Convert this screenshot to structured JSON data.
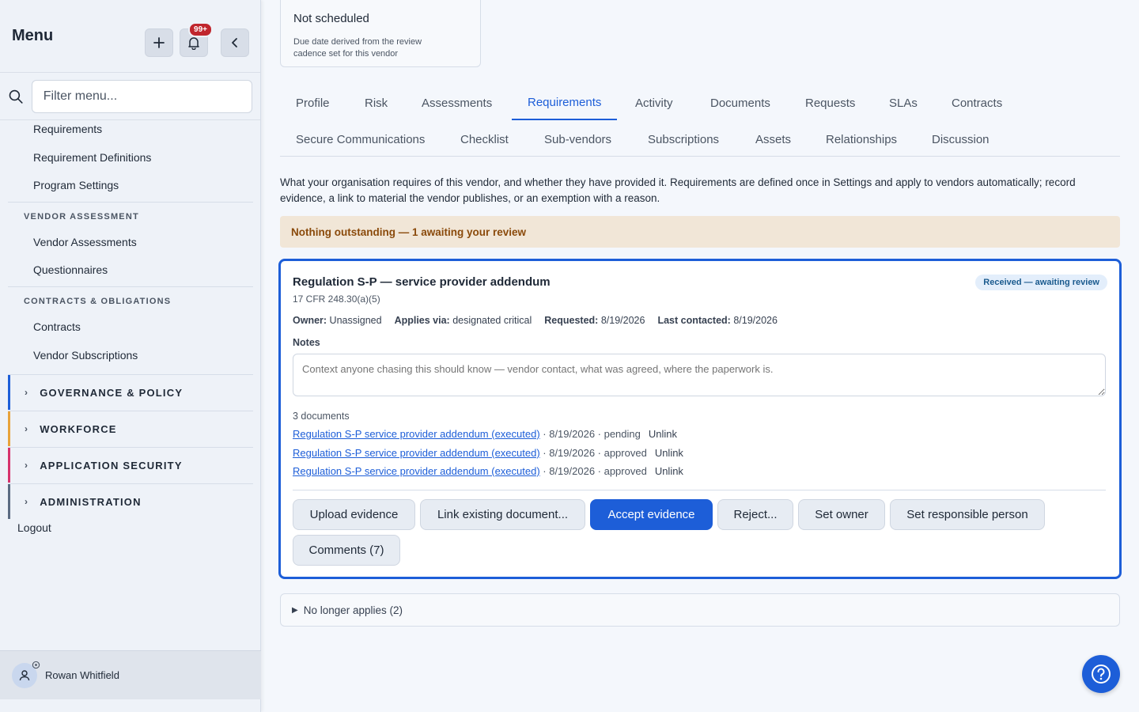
{
  "sidebar": {
    "title": "Menu",
    "badge": "99+",
    "filter_placeholder": "Filter menu...",
    "links": [
      "Requirements",
      "Requirement Definitions",
      "Program Settings"
    ],
    "vendor_assessment": {
      "heading": "VENDOR ASSESSMENT",
      "links": [
        "Vendor Assessments",
        "Questionnaires"
      ]
    },
    "contracts": {
      "heading": "CONTRACTS & OBLIGATIONS",
      "links": [
        "Contracts",
        "Vendor Subscriptions"
      ]
    },
    "groups": [
      {
        "label": "GOVERNANCE & POLICY",
        "color": "#1d5ed8"
      },
      {
        "label": "WORKFORCE",
        "color": "#e8a33a"
      },
      {
        "label": "APPLICATION SECURITY",
        "color": "#d6336c"
      },
      {
        "label": "ADMINISTRATION",
        "color": "#5b6b82"
      }
    ],
    "logout": "Logout",
    "user": "Rowan Whitfield"
  },
  "schedule": {
    "title": "Not scheduled",
    "subtitle": "Due date derived from the review cadence set for this vendor"
  },
  "tabs": {
    "row1": [
      "Profile",
      "Risk",
      "Assessments",
      "Requirements",
      "Activity",
      "Documents",
      "Requests",
      "SLAs",
      "Contracts"
    ],
    "row2": [
      "Secure Communications",
      "Checklist",
      "Sub-vendors",
      "Subscriptions",
      "Assets",
      "Relationships",
      "Discussion"
    ],
    "active": "Requirements"
  },
  "description": "What your organisation requires of this vendor, and whether they have provided it. Requirements are defined once in Settings and apply to vendors automatically; record evidence, a link to material the vendor publishes, or an exemption with a reason.",
  "banner": "Nothing outstanding — 1 awaiting your review",
  "requirement": {
    "title": "Regulation S-P — service provider addendum",
    "citation": "17 CFR 248.30(a)(5)",
    "status": "Received — awaiting review",
    "owner_label": "Owner:",
    "owner": "Unassigned",
    "applies_label": "Applies via:",
    "applies": "designated critical",
    "requested_label": "Requested:",
    "requested": "8/19/2026",
    "contacted_label": "Last contacted:",
    "contacted": "8/19/2026",
    "notes_label": "Notes",
    "notes_placeholder": "Context anyone chasing this should know — vendor contact, what was agreed, where the paperwork is.",
    "doc_count": "3 documents",
    "documents": [
      {
        "name": "Regulation S-P service provider addendum (executed)",
        "meta": " · 8/19/2026 · pending",
        "action": "Unlink"
      },
      {
        "name": "Regulation S-P service provider addendum (executed)",
        "meta": " · 8/19/2026 · approved",
        "action": "Unlink"
      },
      {
        "name": "Regulation S-P service provider addendum (executed)",
        "meta": " · 8/19/2026 · approved",
        "action": "Unlink"
      }
    ],
    "actions": {
      "upload": "Upload evidence",
      "link": "Link existing document...",
      "accept": "Accept evidence",
      "reject": "Reject...",
      "owner": "Set owner",
      "responsible": "Set responsible person",
      "comments": "Comments (7)"
    }
  },
  "no_longer_applies": "No longer applies (2)"
}
